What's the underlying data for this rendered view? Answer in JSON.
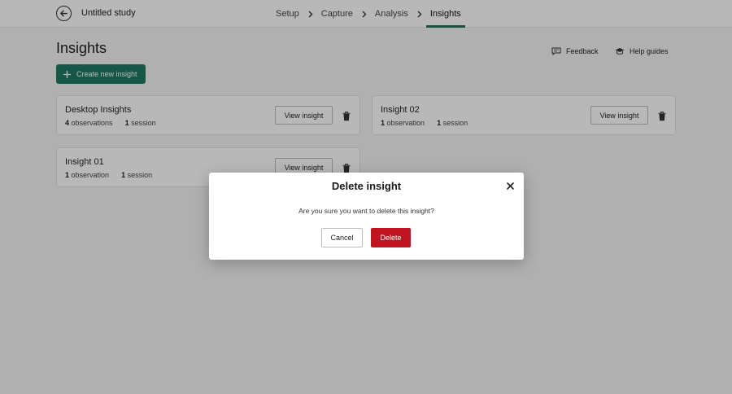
{
  "header": {
    "study_title": "Untitled study",
    "steps": [
      {
        "label": "Setup"
      },
      {
        "label": "Capture"
      },
      {
        "label": "Analysis"
      },
      {
        "label": "Insights"
      }
    ],
    "active_step": "Insights"
  },
  "page": {
    "title": "Insights",
    "create_button": "Create new insight",
    "feedback_link": "Feedback",
    "help_link": "Help guides"
  },
  "cards": [
    {
      "title": "Desktop Insights",
      "observations_count": "4",
      "observations_label": "observations",
      "sessions_count": "1",
      "sessions_label": "session",
      "view_label": "View insight"
    },
    {
      "title": "Insight 02",
      "observations_count": "1",
      "observations_label": "observation",
      "sessions_count": "1",
      "sessions_label": "session",
      "view_label": "View insight"
    },
    {
      "title": "Insight 01",
      "observations_count": "1",
      "observations_label": "observation",
      "sessions_count": "1",
      "sessions_label": "session",
      "view_label": "View insight"
    }
  ],
  "modal": {
    "title": "Delete insight",
    "message": "Are you sure you want to delete this insight?",
    "cancel_label": "Cancel",
    "delete_label": "Delete"
  },
  "colors": {
    "accent": "#1f7a63",
    "danger": "#c0131f"
  }
}
